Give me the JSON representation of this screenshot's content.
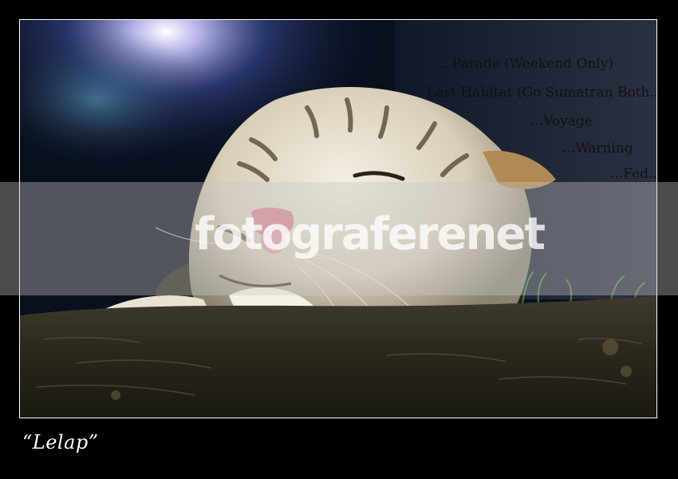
{
  "photo": {
    "subject": "white-tiger-resting-on-log",
    "background_sign_lines": [
      "... Parade (Weekend Only)",
      "Last Habitat (Go Sumatran Both...",
      "...Voyage",
      "...Warning",
      "...Fed..."
    ]
  },
  "watermark": {
    "text": "fotograferenet"
  },
  "caption": {
    "text": "“Lelap”"
  }
}
